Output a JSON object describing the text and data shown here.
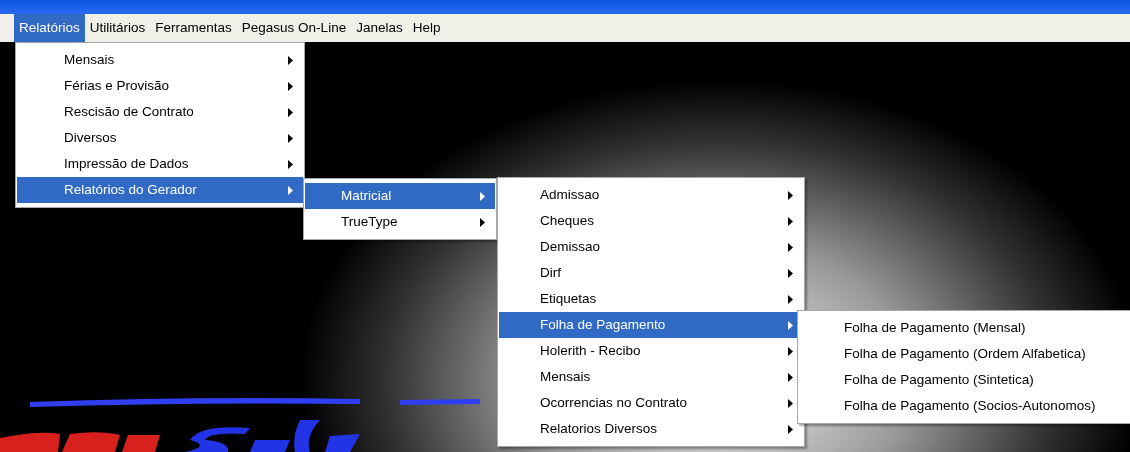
{
  "menu_bar": [
    {
      "label": "Relatórios",
      "selected": true
    },
    {
      "label": "Utilitários",
      "selected": false
    },
    {
      "label": "Ferramentas",
      "selected": false
    },
    {
      "label": "Pegasus On-Line",
      "selected": false
    },
    {
      "label": "Janelas",
      "selected": false
    },
    {
      "label": "Help",
      "selected": false
    }
  ],
  "menus": [
    {
      "items": [
        {
          "label": "Mensais",
          "selected": false,
          "has_submenu": true
        },
        {
          "label": "Férias e Provisão",
          "selected": false,
          "has_submenu": true
        },
        {
          "label": "Rescisão de Contrato",
          "selected": false,
          "has_submenu": true
        },
        {
          "label": "Diversos",
          "selected": false,
          "has_submenu": true
        },
        {
          "label": "Impressão de Dados",
          "selected": false,
          "has_submenu": true
        },
        {
          "label": "Relatórios do Gerador",
          "selected": true,
          "has_submenu": true
        }
      ]
    },
    {
      "items": [
        {
          "label": "Matricial",
          "selected": true,
          "has_submenu": true
        },
        {
          "label": "TrueType",
          "selected": false,
          "has_submenu": true
        }
      ]
    },
    {
      "items": [
        {
          "label": "Admissao",
          "selected": false,
          "has_submenu": true
        },
        {
          "label": "Cheques",
          "selected": false,
          "has_submenu": true
        },
        {
          "label": "Demissao",
          "selected": false,
          "has_submenu": true
        },
        {
          "label": "Dirf",
          "selected": false,
          "has_submenu": true
        },
        {
          "label": "Etiquetas",
          "selected": false,
          "has_submenu": true
        },
        {
          "label": "Folha de Pagamento",
          "selected": true,
          "has_submenu": true
        },
        {
          "label": "Holerith - Recibo",
          "selected": false,
          "has_submenu": true
        },
        {
          "label": "Mensais",
          "selected": false,
          "has_submenu": true
        },
        {
          "label": "Ocorrencias no Contrato",
          "selected": false,
          "has_submenu": true
        },
        {
          "label": "Relatorios Diversos",
          "selected": false,
          "has_submenu": true
        }
      ]
    },
    {
      "items": [
        {
          "label": "Folha de Pagamento (Mensal)",
          "selected": false,
          "has_submenu": false
        },
        {
          "label": "Folha de Pagamento (Ordem Alfabetica)",
          "selected": false,
          "has_submenu": false
        },
        {
          "label": "Folha de Pagamento (Sintetica)",
          "selected": false,
          "has_submenu": false
        },
        {
          "label": "Folha de Pagamento (Socios-Autonomos)",
          "selected": false,
          "has_submenu": false
        }
      ]
    }
  ]
}
